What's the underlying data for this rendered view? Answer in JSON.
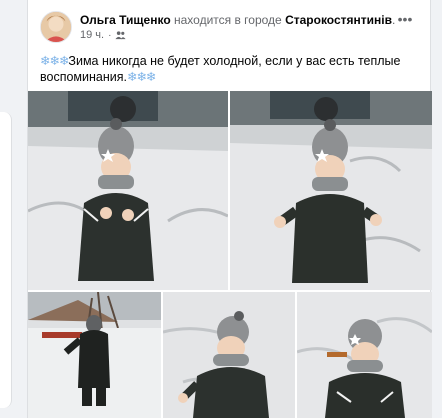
{
  "post": {
    "author": "Ольга Тищенко",
    "location_prefix": "находится в городе",
    "location": "Старокостянтинів",
    "location_suffix": ".",
    "time": "19 ч.",
    "separator": "·",
    "text_prefix_emoji": "❄❄❄",
    "text": "Зима никогда не будет холодной, если у вас есть теплые воспоминания.",
    "text_suffix_emoji": "❄❄❄",
    "more_icon": "•••"
  },
  "photos": [
    {
      "name": "photo-boy-smiling-snow",
      "subject": "child in knit hat smiling in snow"
    },
    {
      "name": "photo-boy-standing-snow",
      "subject": "child standing in snow"
    },
    {
      "name": "photo-boy-walking-yard",
      "subject": "child walking in snowy yard"
    },
    {
      "name": "photo-boy-looking-up",
      "subject": "child looking up"
    },
    {
      "name": "photo-boy-laughing",
      "subject": "child laughing"
    }
  ],
  "colors": {
    "page_bg": "#f0f2f5",
    "text": "#050505",
    "secondary_text": "#65676b",
    "snowflake": "#7fb4e8"
  },
  "icons": {
    "audience": "friends-icon",
    "options": "more-options-icon"
  }
}
